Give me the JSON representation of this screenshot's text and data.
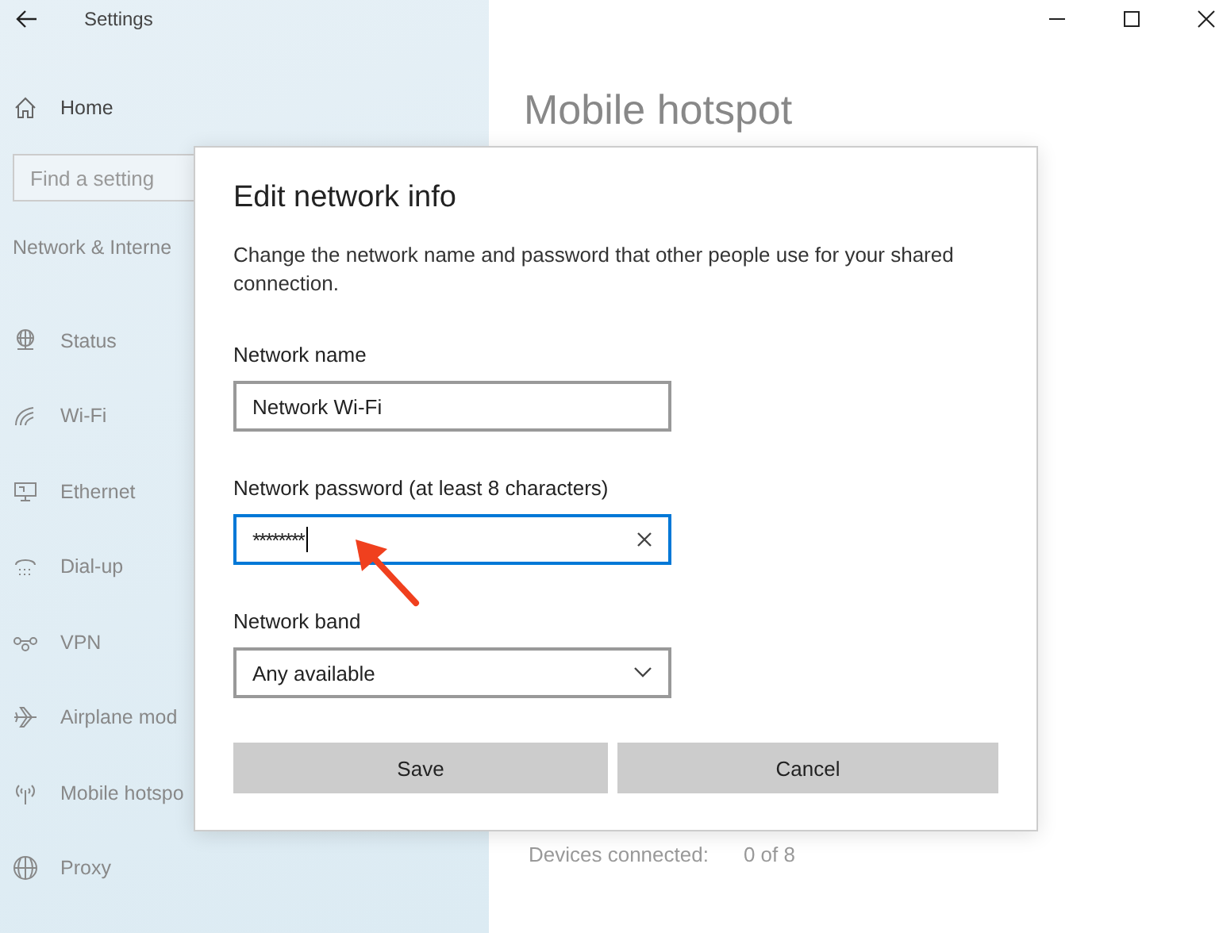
{
  "window": {
    "title": "Settings"
  },
  "sidebar": {
    "home": "Home",
    "search": {
      "placeholder": "Find a setting"
    },
    "section": "Network & Interne",
    "items": [
      {
        "label": "Status"
      },
      {
        "label": "Wi-Fi"
      },
      {
        "label": "Ethernet"
      },
      {
        "label": "Dial-up"
      },
      {
        "label": "VPN"
      },
      {
        "label": "Airplane mod"
      },
      {
        "label": "Mobile hotspo"
      },
      {
        "label": "Proxy"
      }
    ]
  },
  "page": {
    "title": "Mobile hotspot",
    "devices_label": "Devices connected:",
    "devices_value": "0 of 8"
  },
  "dialog": {
    "title": "Edit network info",
    "description": "Change the network name and password that other people use for your shared connection.",
    "fields": [
      {
        "kind": "text",
        "label": "Network name",
        "value": "Network Wi-Fi",
        "focused": false
      },
      {
        "kind": "password",
        "label": "Network password (at least 8 characters)",
        "value": "********",
        "focused": true
      },
      {
        "kind": "select",
        "label": "Network band",
        "value": "Any available",
        "focused": false
      }
    ],
    "buttons": [
      "Save",
      "Cancel"
    ]
  }
}
